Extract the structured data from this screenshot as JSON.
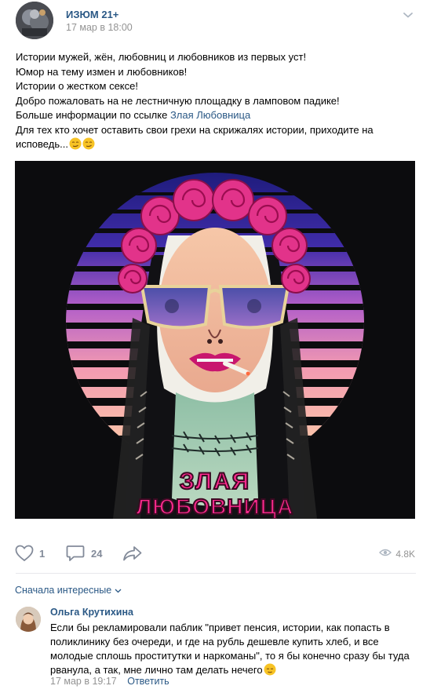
{
  "post": {
    "author": "ИЗЮМ 21+",
    "date": "17 мар в 18:00",
    "text_lines": [
      "Истории мужей, жён, любовниц и любовников из первых уст!",
      "Юмор на тему измен и любовников!",
      "Истории о жестком сексе!",
      "Добро пожаловать на не лестничную площадку в ламповом падике!"
    ],
    "link_prefix": "Больше информации по ссылке ",
    "link_text": "Злая Любовница",
    "text_tail_1": "Для тех кто хочет оставить свои грехи на скрижалях истории, приходите на",
    "text_tail_2": "исповедь...",
    "image_caption": "ЗЛАЯ ЛЮБОВНИЦА",
    "image_caption_line1": "ЗЛАЯ",
    "image_caption_line2": "ЛЮБОВНИЦА"
  },
  "actions": {
    "likes": "1",
    "comments": "24",
    "views": "4.8K"
  },
  "comments_section": {
    "sort_label": "Сначала интересные"
  },
  "comment": {
    "author": "Ольга Крутихина",
    "text_lines": [
      "Если бы рекламировали паблик \"привет пенсия, истории, как попасть в",
      "поликлинику без очереди, и где на рубль дешевле купить хлеб, и все",
      "молодые сплошь проститутки и наркоманы\", то я бы конечно сразу бы туда",
      "рванула, а так, мне лично там делать нечего"
    ],
    "date": "17 мар в 19:17",
    "reply_label": "Ответить"
  },
  "icons": {
    "like": "heart-icon",
    "comment": "comment-bubble-icon",
    "share": "share-arrow-icon",
    "views": "eye-icon",
    "more": "chevron-down-icon"
  },
  "colors": {
    "link": "#2a5885",
    "meta": "#939393",
    "action": "#828a99",
    "image_pink": "#ff2a8f"
  }
}
